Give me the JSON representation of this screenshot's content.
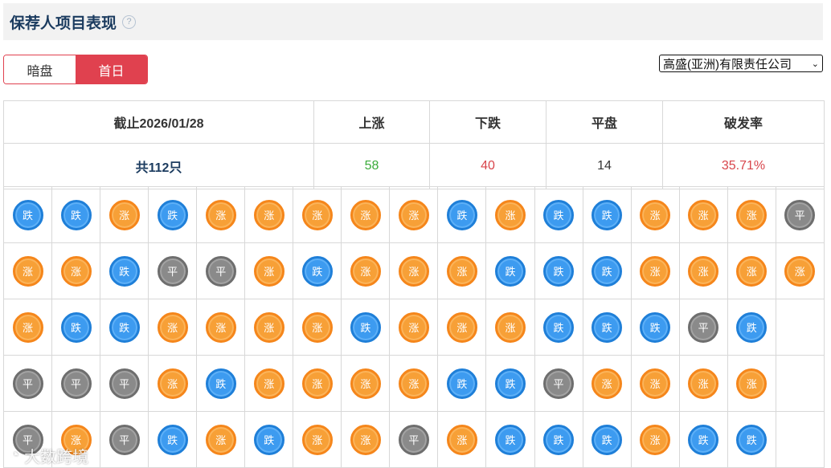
{
  "header": {
    "title": "保荐人项目表现",
    "help_icon": "?"
  },
  "tabs": [
    {
      "label": "暗盘",
      "active": false
    },
    {
      "label": "首日",
      "active": true
    }
  ],
  "broker_select": {
    "value": "高盛(亚洲)有限责任公司",
    "arrow": "⌄"
  },
  "summary": {
    "headers": [
      "截止2026/01/28",
      "上涨",
      "下跌",
      "平盘",
      "破发率"
    ],
    "total": "共112只",
    "up": "58",
    "down": "40",
    "flat": "14",
    "break_rate": "35.71%"
  },
  "legend": {
    "up": "涨",
    "down": "跌",
    "flat": "平"
  },
  "grid": [
    [
      "跌",
      "跌",
      "涨",
      "跌",
      "涨",
      "涨",
      "涨",
      "涨",
      "涨",
      "跌",
      "涨",
      "跌",
      "跌",
      "涨",
      "涨",
      "涨",
      "平"
    ],
    [
      "涨",
      "涨",
      "跌",
      "平",
      "平",
      "涨",
      "跌",
      "涨",
      "涨",
      "涨",
      "跌",
      "跌",
      "跌",
      "涨",
      "涨",
      "涨",
      "涨"
    ],
    [
      "涨",
      "跌",
      "跌",
      "涨",
      "涨",
      "涨",
      "涨",
      "跌",
      "涨",
      "涨",
      "涨",
      "跌",
      "跌",
      "跌",
      "平",
      "跌",
      ""
    ],
    [
      "平",
      "平",
      "平",
      "涨",
      "跌",
      "涨",
      "涨",
      "涨",
      "涨",
      "跌",
      "跌",
      "平",
      "涨",
      "涨",
      "涨",
      "涨",
      ""
    ],
    [
      "平",
      "涨",
      "平",
      "跌",
      "涨",
      "跌",
      "涨",
      "涨",
      "平",
      "涨",
      "跌",
      "跌",
      "跌",
      "涨",
      "跌",
      "跌",
      ""
    ]
  ],
  "watermark": "大数跨境",
  "colors": {
    "accent": "#e0414f",
    "up_coin": "#f7a037",
    "down_coin": "#3d9bf0",
    "flat_coin": "#8a8a8a"
  }
}
